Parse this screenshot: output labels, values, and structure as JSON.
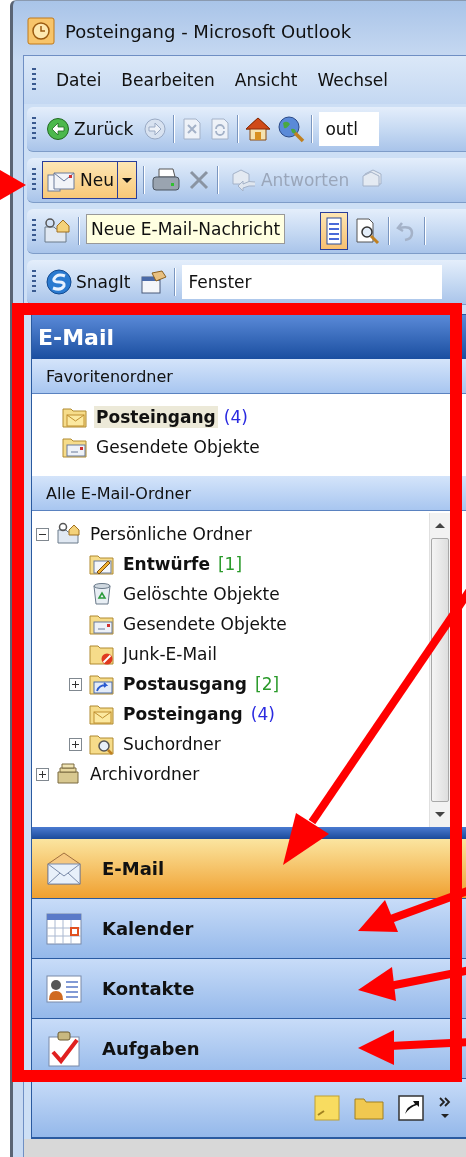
{
  "window": {
    "title": "Posteingang - Microsoft Outlook"
  },
  "menu": [
    {
      "label": "Datei"
    },
    {
      "label": "Bearbeiten"
    },
    {
      "label": "Ansicht"
    },
    {
      "label": "Wechsel"
    }
  ],
  "toolbar_web": {
    "back": {
      "label": "Zurück"
    },
    "address": {
      "value": "outl"
    }
  },
  "toolbar_standard": {
    "new": {
      "label": "Neu",
      "hot": true
    },
    "reply": {
      "label": "Antworten",
      "disabled": true
    }
  },
  "toolbar_advanced": {
    "tooltip": "Neue E-Mail-Nachricht"
  },
  "toolbar_snagit": {
    "snagit": {
      "label": "SnagIt"
    },
    "field": {
      "value": "Fenster"
    }
  },
  "navigation_pane": {
    "header": "E-Mail",
    "favorites": {
      "title": "Favoritenordner",
      "items": [
        {
          "name": "Posteingang",
          "kind": "inbox",
          "bold": true,
          "selected": true,
          "count": {
            "text": "(4)",
            "kind": "unread"
          }
        },
        {
          "name": "Gesendete Objekte",
          "kind": "sent",
          "bold": false,
          "selected": false
        }
      ]
    },
    "all_folders": {
      "title": "Alle E-Mail-Ordner",
      "tree": [
        {
          "name": "Persönliche Ordner",
          "kind": "personal",
          "bold": false,
          "selected": false,
          "expanded": true,
          "children": [
            {
              "name": "Entwürfe",
              "kind": "drafts",
              "bold": true,
              "selected": false,
              "count": {
                "text": "[1]",
                "kind": "total"
              }
            },
            {
              "name": "Gelöschte Objekte",
              "kind": "deleted",
              "bold": false,
              "selected": false
            },
            {
              "name": "Gesendete Objekte",
              "kind": "sent",
              "bold": false,
              "selected": false
            },
            {
              "name": "Junk-E-Mail",
              "kind": "junk",
              "bold": false,
              "selected": false
            },
            {
              "name": "Postausgang",
              "kind": "outbox",
              "bold": true,
              "selected": false,
              "expanded": false,
              "count": {
                "text": "[2]",
                "kind": "total"
              }
            },
            {
              "name": "Posteingang",
              "kind": "inbox",
              "bold": true,
              "selected": false,
              "count": {
                "text": "(4)",
                "kind": "unread"
              }
            },
            {
              "name": "Suchordner",
              "kind": "search",
              "bold": false,
              "selected": false,
              "expanded": false
            }
          ]
        },
        {
          "name": "Archivordner",
          "kind": "archive",
          "bold": false,
          "selected": false,
          "expanded": false
        }
      ]
    },
    "buttons": [
      {
        "label": "E-Mail",
        "kind": "mail",
        "selected": true
      },
      {
        "label": "Kalender",
        "kind": "calendar",
        "selected": false
      },
      {
        "label": "Kontakte",
        "kind": "contacts",
        "selected": false
      },
      {
        "label": "Aufgaben",
        "kind": "tasks",
        "selected": false
      }
    ]
  }
}
